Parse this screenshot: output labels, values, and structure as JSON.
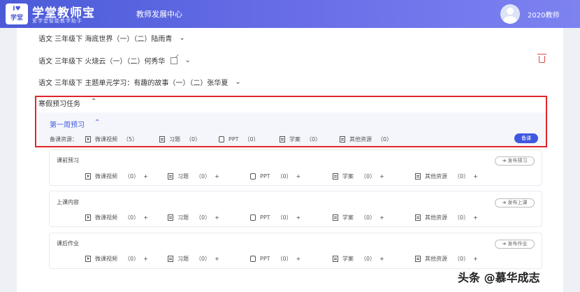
{
  "header": {
    "logo_icon_line1": "I♥",
    "logo_icon_line2": "学堂",
    "logo_title": "学堂教师宝",
    "logo_subtitle": "爱学堂智能教学助手",
    "nav_title": "教师发展中心",
    "user_name": "2020教师"
  },
  "lessons": [
    {
      "label": "语文  三年级下  海底世界（一）（二）陆雨青"
    },
    {
      "label": "语文  三年级下  火烧云（一）（二）何秀华"
    },
    {
      "label": "语文  三年级下  主题单元学习：有趣的故事（一）（二）张华夏"
    }
  ],
  "winter_task": {
    "title": "寒假预习任务",
    "week": {
      "title": "第一周预习",
      "resource_label": "备课资源：",
      "resources": [
        {
          "icon": "video-icon",
          "label": "微课视频",
          "count": "（5）"
        },
        {
          "icon": "exercise-icon",
          "label": "习题",
          "count": "（0）"
        },
        {
          "icon": "ppt-icon",
          "label": "PPT",
          "count": "（0）"
        },
        {
          "icon": "plan-icon",
          "label": "学案",
          "count": "（0）"
        },
        {
          "icon": "other-resource-icon",
          "label": "其他资源",
          "count": "（0）"
        }
      ],
      "prep_button": "备课"
    }
  },
  "sections": [
    {
      "title": "课前预习",
      "button": "➜ 发布预习",
      "items": [
        {
          "icon": "video-icon",
          "label": "微课视频",
          "count": "（0）",
          "plus": "+"
        },
        {
          "icon": "exercise-icon",
          "label": "习题",
          "count": "（0）",
          "plus": "+"
        },
        {
          "icon": "ppt-icon",
          "label": "PPT",
          "count": "（0）",
          "plus": "+"
        },
        {
          "icon": "plan-icon",
          "label": "学案",
          "count": "（0）",
          "plus": "+"
        },
        {
          "icon": "other-resource-icon",
          "label": "其他资源",
          "count": "（0）",
          "plus": "+"
        }
      ]
    },
    {
      "title": "上课内容",
      "button": "➜ 发布上课",
      "items": [
        {
          "icon": "video-icon",
          "label": "微课视频",
          "count": "（0）",
          "plus": "+"
        },
        {
          "icon": "exercise-icon",
          "label": "习题",
          "count": "（0）",
          "plus": "+"
        },
        {
          "icon": "ppt-icon",
          "label": "PPT",
          "count": "（0）",
          "plus": "+"
        },
        {
          "icon": "plan-icon",
          "label": "学案",
          "count": "（0）",
          "plus": "+"
        },
        {
          "icon": "other-resource-icon",
          "label": "其他资源",
          "count": "（0）",
          "plus": "+"
        }
      ]
    },
    {
      "title": "课后作业",
      "button": "➜ 发布作业",
      "items": [
        {
          "icon": "video-icon",
          "label": "微课视频",
          "count": "（0）",
          "plus": "+"
        },
        {
          "icon": "exercise-icon",
          "label": "习题",
          "count": "（0）",
          "plus": "+"
        },
        {
          "icon": "ppt-icon",
          "label": "PPT",
          "count": "（0）",
          "plus": "+"
        },
        {
          "icon": "plan-icon",
          "label": "学案",
          "count": "（0）",
          "plus": "+"
        },
        {
          "icon": "other-resource-icon",
          "label": "其他资源",
          "count": "（0）",
          "plus": "+"
        }
      ]
    }
  ],
  "watermark": "头条 @慕华成志",
  "colors": {
    "accent": "#3f58e0",
    "highlight": "#e0262b",
    "delete": "#e04545"
  }
}
